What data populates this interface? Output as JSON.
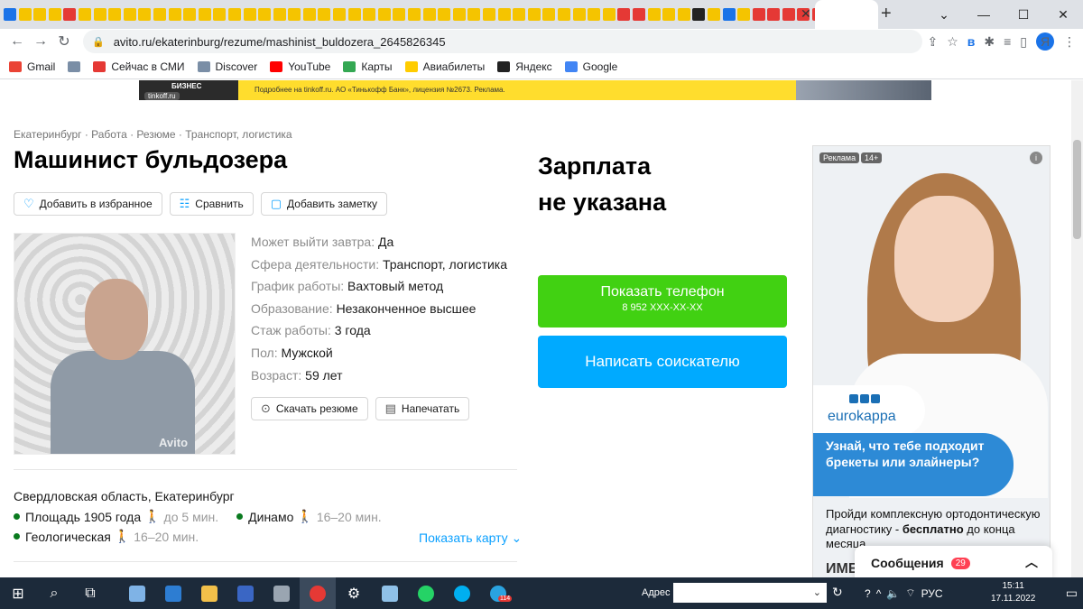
{
  "browser": {
    "url": "avito.ru/ekaterinburg/rezume/mashinist_buldozera_2645826345",
    "profile_letter": "Я",
    "window_controls": [
      "—",
      "☐",
      "✕"
    ],
    "new_tab": "+",
    "tab_close": "✕"
  },
  "bookmarks": [
    {
      "label": "Gmail",
      "color": "#ea4335"
    },
    {
      "label": "",
      "color": "#7a8ea6"
    },
    {
      "label": "Сейчас в СМИ",
      "color": "#e53935"
    },
    {
      "label": "Discover",
      "color": "#7a8ea6"
    },
    {
      "label": "YouTube",
      "color": "#ff0000"
    },
    {
      "label": "Карты",
      "color": "#34a853"
    },
    {
      "label": "Авиабилеты",
      "color": "#ffcc00"
    },
    {
      "label": "Яндекс",
      "color": "#222222"
    },
    {
      "label": "Google",
      "color": "#4285f4"
    }
  ],
  "top_ad": {
    "brand": "БИЗНЕС",
    "domain": "tinkoff.ru",
    "text": "Подробнее на tinkoff.ru. АО «Тинькофф Банк», лицензия №2673. Реклама."
  },
  "breadcrumbs": "Екатеринбург · Работа · Резюме · Транспорт, логистика",
  "title": "Машинист бульдозера",
  "actions": {
    "favorite": "Добавить в избранное",
    "compare": "Сравнить",
    "note": "Добавить заметку"
  },
  "photo_watermark": "Avito",
  "details": [
    {
      "key": "Может выйти завтра:",
      "value": "Да"
    },
    {
      "key": "Сфера деятельности:",
      "value": "Транспорт, логистика"
    },
    {
      "key": "График работы:",
      "value": "Вахтовый метод"
    },
    {
      "key": "Образование:",
      "value": "Незаконченное высшее"
    },
    {
      "key": "Стаж работы:",
      "value": "3 года"
    },
    {
      "key": "Пол:",
      "value": "Мужской"
    },
    {
      "key": "Возраст:",
      "value": "59 лет"
    }
  ],
  "buttons": {
    "download": "Скачать резюме",
    "print": "Напечатать"
  },
  "location": {
    "address": "Свердловская область, Екатеринбург",
    "metro": [
      {
        "name": "Площадь 1905 года",
        "time": "до 5 мин."
      },
      {
        "name": "Динамо",
        "time": "16–20 мин."
      },
      {
        "name": "Геологическая",
        "time": "16–20 мин."
      }
    ],
    "show_map": "Показать карту"
  },
  "salary": {
    "line1": "Зарплата",
    "line2": "не указана"
  },
  "contact": {
    "show_phone": "Показать телефон",
    "phone_masked": "8 952 XXX-XX-XX",
    "write": "Написать соискателю"
  },
  "side_ad": {
    "label": "Реклама",
    "age": "14+",
    "brand": "eurokappa",
    "headline": "Узнай, что тебе подходит брекеты или элайнеры?",
    "text_before": "Пройди комплексную ортодонтическую диагностику - ",
    "text_bold": "бесплатно",
    "text_after": " до конца месяца",
    "cut_text": "ИМЕ"
  },
  "messages": {
    "label": "Сообщения",
    "count": "29"
  },
  "taskbar": {
    "address_label": "Адрес",
    "telegram_badge": "114",
    "lang": "РУС",
    "time": "15:11",
    "date": "17.11.2022"
  },
  "colors": {
    "green": "#41d112",
    "blue": "#00aaff",
    "accent_link": "#0aa0ff"
  }
}
